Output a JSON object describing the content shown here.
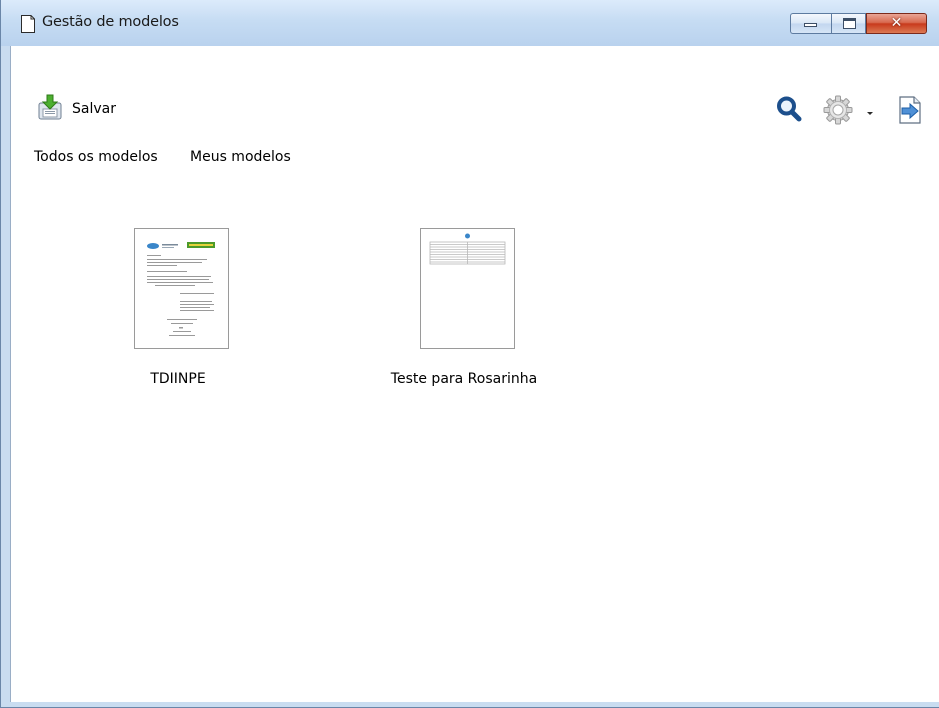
{
  "window": {
    "title": "Gestão de modelos"
  },
  "toolbar": {
    "save_label": "Salvar",
    "icons": [
      "save-icon",
      "search-icon",
      "gear-icon",
      "dropdown-arrow-icon",
      "import-icon"
    ]
  },
  "tabs": [
    {
      "label": "Todos os modelos"
    },
    {
      "label": "Meus modelos"
    }
  ],
  "templates": [
    {
      "label": "TDIINPE",
      "thumbnail": "document-thumbnail-letter"
    },
    {
      "label": "Teste para Rosarinha",
      "thumbnail": "document-thumbnail-table"
    }
  ],
  "colors": {
    "titlebar": "#c6dcf3",
    "close_button": "#c83a1c",
    "accent_blue": "#1c4f8c",
    "brand_green": "#4c9a2a"
  }
}
